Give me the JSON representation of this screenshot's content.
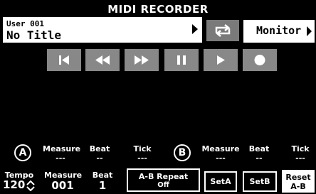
{
  "header": {
    "title": "MIDI RECORDER"
  },
  "song": {
    "user": "User 001",
    "name": "No Title"
  },
  "monitor": {
    "label": "Monitor"
  },
  "transport": {
    "buttons": [
      "to-start-icon",
      "rewind-icon",
      "fast-forward-icon",
      "pause-icon",
      "play-icon",
      "record-icon"
    ]
  },
  "pointA": {
    "badge": "A",
    "measure_label": "Measure",
    "measure_value": "---",
    "beat_label": "Beat",
    "beat_value": "--",
    "tick_label": "Tick",
    "tick_value": "---"
  },
  "pointB": {
    "badge": "B",
    "measure_label": "Measure",
    "measure_value": "---",
    "beat_label": "Beat",
    "beat_value": "--",
    "tick_label": "Tick",
    "tick_value": "---"
  },
  "position": {
    "tempo_label": "Tempo",
    "tempo_value": "120",
    "measure_label": "Measure",
    "measure_value": "001",
    "beat_label": "Beat",
    "beat_value": "1"
  },
  "ab_repeat": {
    "label": "A-B Repeat",
    "state": "Off"
  },
  "buttons": {
    "set_a": "SetA",
    "set_b": "SetB",
    "reset_line1": "Reset",
    "reset_line2": "A-B"
  }
}
